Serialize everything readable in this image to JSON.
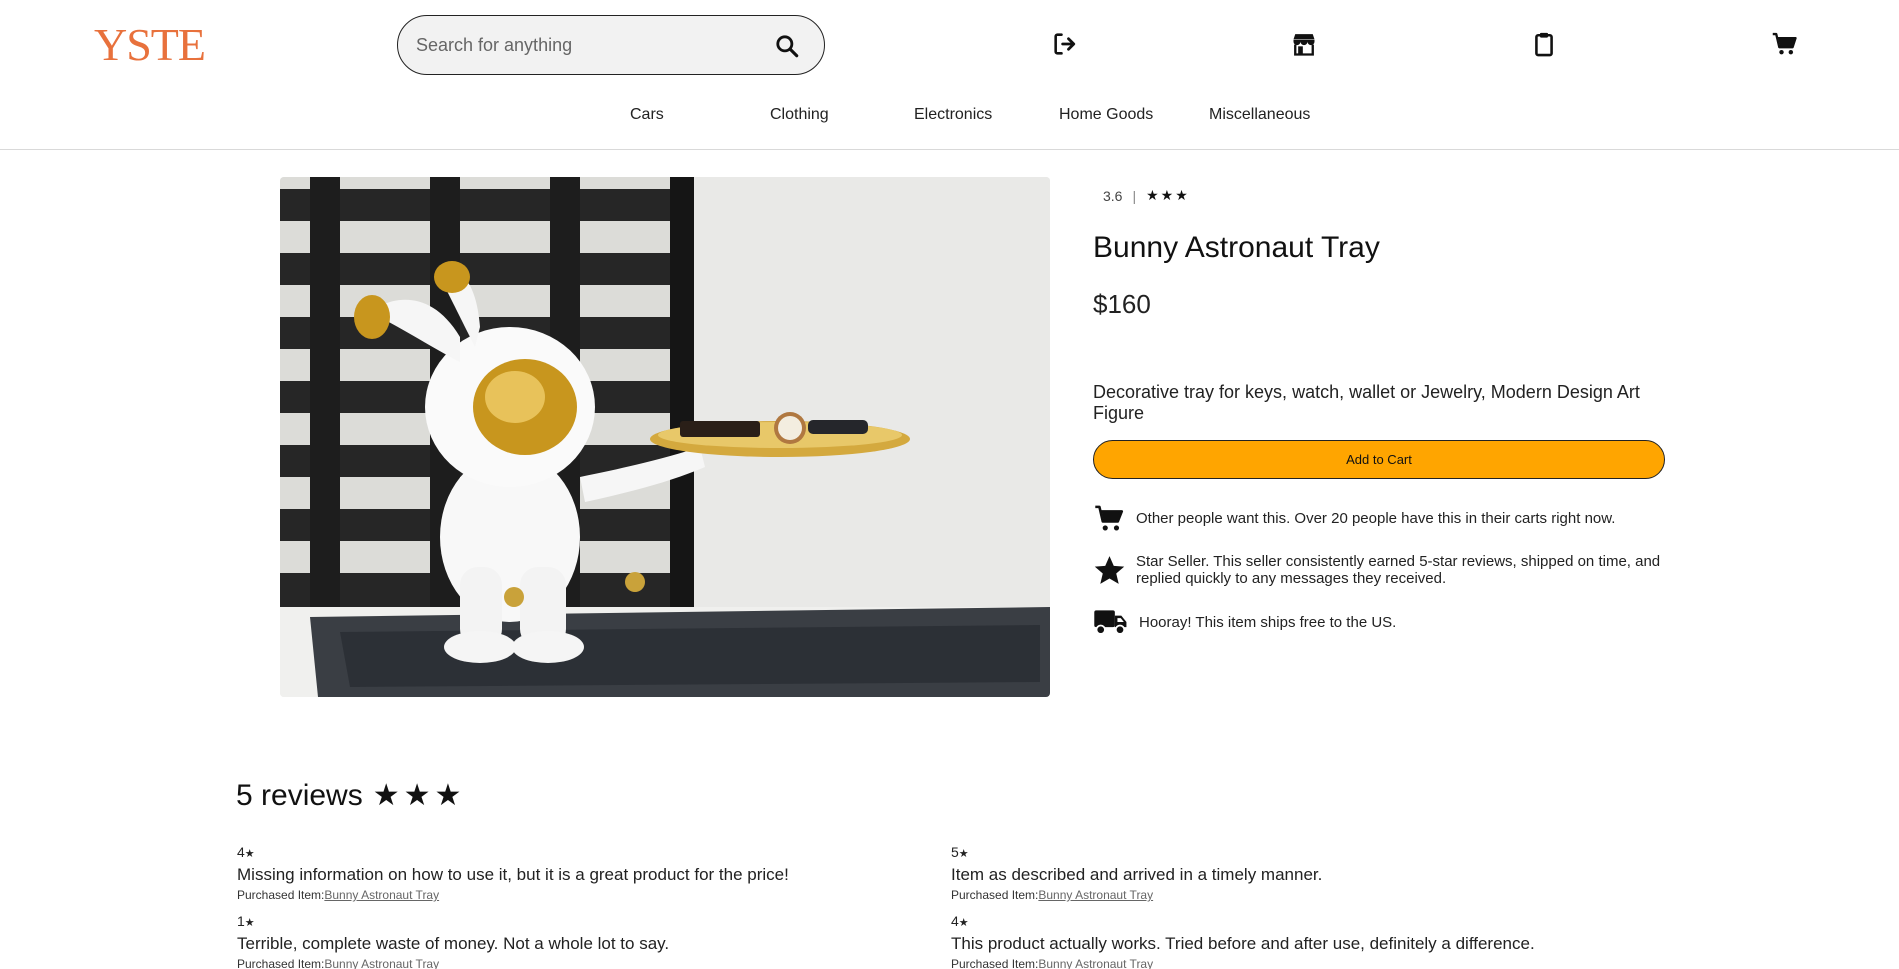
{
  "header": {
    "logo": "YSTE",
    "search": {
      "placeholder": "Search for anything",
      "value": ""
    },
    "icons": [
      "sign-out-icon",
      "store-icon",
      "clipboard-icon",
      "cart-icon"
    ]
  },
  "nav": {
    "items": [
      "Cars",
      "Clothing",
      "Electronics",
      "Home Goods",
      "Miscellaneous"
    ]
  },
  "product": {
    "rating": "3.6",
    "rating_separator": "|",
    "rating_stars": "★★★",
    "title": "Bunny Astronaut Tray",
    "price": "$160",
    "description": "Decorative tray for keys, watch, wallet or Jewelry, Modern Design Art Figure",
    "add_to_cart": "Add to Cart",
    "features": [
      {
        "icon": "cart-icon",
        "text": "Other people want this. Over 20 people have this in their carts right now."
      },
      {
        "icon": "star-icon",
        "text": "Star Seller. This seller consistently earned 5-star reviews, shipped on time, and replied quickly to any messages they received."
      },
      {
        "icon": "truck-icon",
        "text": "Hooray! This item ships free to the US."
      }
    ]
  },
  "reviews": {
    "heading": "5 reviews",
    "heading_stars": "★★★",
    "purchased_label": "Purchased Item:",
    "items": [
      {
        "rating": "4",
        "text": "Missing information on how to use it, but it is a great product for the price!",
        "item": "Bunny Astronaut Tray"
      },
      {
        "rating": "5",
        "text": "Item as described and arrived in a timely manner.",
        "item": "Bunny Astronaut Tray"
      },
      {
        "rating": "1",
        "text": "Terrible, complete waste of money. Not a whole lot to say.",
        "item": "Bunny Astronaut Tray"
      },
      {
        "rating": "4",
        "text": "This product actually works. Tried before and after use, definitely a difference.",
        "item": "Bunny Astronaut Tray"
      }
    ]
  },
  "colors": {
    "logo": "#e8713c",
    "add_to_cart": "#ffa500"
  }
}
